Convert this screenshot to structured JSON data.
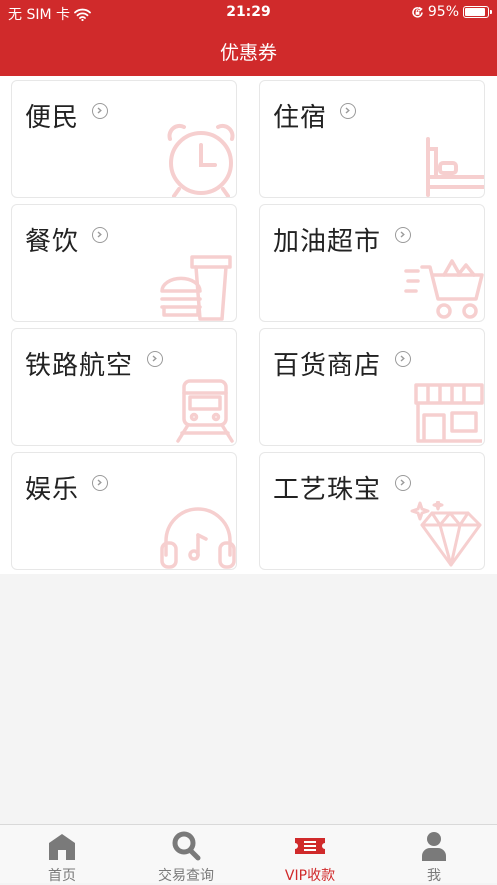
{
  "status": {
    "carrier": "无 SIM 卡",
    "time": "21:29",
    "battery": "95%",
    "battery_level": 0.95
  },
  "nav": {
    "title": "优惠券"
  },
  "colors": {
    "brand": "#d02a2b",
    "illustration": "#f6cfcf",
    "tab_inactive": "#7a7a7a"
  },
  "categories": [
    {
      "label": "便民",
      "icon": "alarm-clock-icon"
    },
    {
      "label": "住宿",
      "icon": "bed-icon"
    },
    {
      "label": "餐饮",
      "icon": "burger-drink-icon"
    },
    {
      "label": "加油超市",
      "icon": "shopping-cart-icon"
    },
    {
      "label": "铁路航空",
      "icon": "train-icon"
    },
    {
      "label": "百货商店",
      "icon": "store-icon"
    },
    {
      "label": "娱乐",
      "icon": "headphones-icon"
    },
    {
      "label": "工艺珠宝",
      "icon": "diamond-icon"
    }
  ],
  "tabs": [
    {
      "label": "首页",
      "icon": "home-icon",
      "active": false
    },
    {
      "label": "交易查询",
      "icon": "search-icon",
      "active": false
    },
    {
      "label": "VIP收款",
      "icon": "ticket-icon",
      "active": true
    },
    {
      "label": "我",
      "icon": "user-icon",
      "active": false
    }
  ]
}
